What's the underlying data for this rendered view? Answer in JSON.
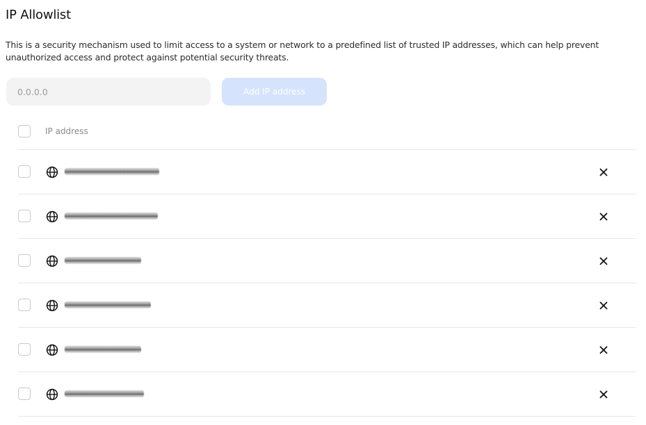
{
  "page": {
    "title": "IP Allowlist",
    "description": "This is a security mechanism used to limit access to a system or network to a predefined list of trusted IP addresses, which can help prevent unauthorized access and protect against potential security threats."
  },
  "form": {
    "ip_placeholder": "0.0.0.0",
    "ip_value": "",
    "add_button_label": "Add IP address",
    "add_button_disabled": true
  },
  "table": {
    "header": {
      "ip_column_label": "IP address"
    },
    "rows": [
      {
        "ip": "███.███.███.███",
        "checked": false
      },
      {
        "ip": "███.███.███.███",
        "checked": false
      },
      {
        "ip": "███.███.███.██",
        "checked": false
      },
      {
        "ip": "███.███.███.███",
        "checked": false
      },
      {
        "ip": "███.███.███.██",
        "checked": false
      },
      {
        "ip": "███.███.███.███",
        "checked": false
      }
    ]
  },
  "icons": {
    "row_icon": "globe-icon",
    "remove_icon": "close-icon"
  },
  "colors": {
    "accent_disabled": "#d6e3fc",
    "input_bg": "#f3f3f4",
    "divider": "#e6e6e6",
    "text_muted": "#8a8a8a"
  }
}
